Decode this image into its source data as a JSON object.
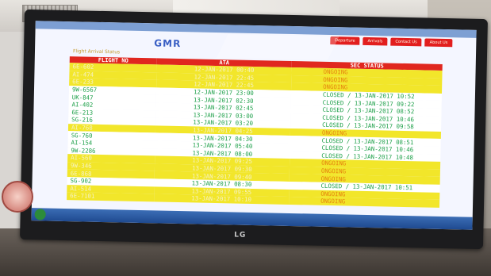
{
  "tv": {
    "brand": "LG"
  },
  "page": {
    "logo": "GMR",
    "subtitle": "Flight Arrival Status",
    "nav_tabs": [
      "Departure",
      "Arrivals",
      "Contact Us",
      "About Us"
    ]
  },
  "table": {
    "headers": [
      "FLIGHT NO",
      "ATA",
      "SEC STATUS"
    ],
    "rows": [
      {
        "flight": "6E-602",
        "ata": "12-JAN-2017 00:40",
        "status": "ONGOING",
        "state": "ongoing"
      },
      {
        "flight": "AI-474",
        "ata": "12-JAN-2017 22:45",
        "status": "ONGOING",
        "state": "ongoing"
      },
      {
        "flight": "6E-233",
        "ata": "12-JAN-2017 22:45",
        "status": "ONGOING",
        "state": "ongoing"
      },
      {
        "flight": "9W-6567",
        "ata": "12-JAN-2017 23:00",
        "status": "CLOSED / 13-JAN-2017 10:52",
        "state": "closed"
      },
      {
        "flight": "UK-847",
        "ata": "13-JAN-2017 02:30",
        "status": "CLOSED / 13-JAN-2017 09:22",
        "state": "closed"
      },
      {
        "flight": "AI-402",
        "ata": "13-JAN-2017 02:45",
        "status": "CLOSED / 13-JAN-2017 08:52",
        "state": "closed"
      },
      {
        "flight": "6E-213",
        "ata": "13-JAN-2017 03:00",
        "status": "CLOSED / 13-JAN-2017 10:46",
        "state": "closed"
      },
      {
        "flight": "SG-216",
        "ata": "13-JAN-2017 03:20",
        "status": "CLOSED / 13-JAN-2017 09:58",
        "state": "closed"
      },
      {
        "flight": "AI-768",
        "ata": "13-JAN-2017 04:25",
        "status": "ONGOING",
        "state": "ongoing"
      },
      {
        "flight": "SG-760",
        "ata": "13-JAN-2017 04:30",
        "status": "CLOSED / 13-JAN-2017 08:51",
        "state": "closed"
      },
      {
        "flight": "AI-154",
        "ata": "13-JAN-2017 05:40",
        "status": "CLOSED / 13-JAN-2017 10:46",
        "state": "closed"
      },
      {
        "flight": "9W-2286",
        "ata": "13-JAN-2017 08:00",
        "status": "CLOSED / 13-JAN-2017 10:48",
        "state": "closed"
      },
      {
        "flight": "AI-560",
        "ata": "13-JAN-2017 09:25",
        "status": "ONGOING",
        "state": "ongoing"
      },
      {
        "flight": "9W-346",
        "ata": "13-JAN-2017 09:30",
        "status": "ONGOING",
        "state": "ongoing"
      },
      {
        "flight": "6E-868",
        "ata": "13-JAN-2017 09:40",
        "status": "ONGOING",
        "state": "ongoing"
      },
      {
        "flight": "SG-902",
        "ata": "13-JAN-2017 08:30",
        "status": "CLOSED / 13-JAN-2017 10:51",
        "state": "closed"
      },
      {
        "flight": "AI-514",
        "ata": "13-JAN-2017 09:55",
        "status": "ONGOING",
        "state": "ongoing"
      },
      {
        "flight": "6E-7101",
        "ata": "13-JAN-2017 10:10",
        "status": "ONGOING",
        "state": "ongoing"
      }
    ]
  }
}
